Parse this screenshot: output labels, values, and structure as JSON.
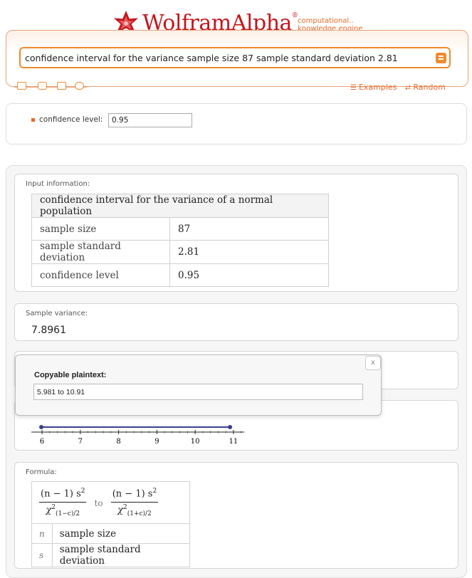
{
  "brand": {
    "name_part1": "Wolfram",
    "name_part2": "Alpha",
    "tagline_line1": "computational..",
    "tagline_line2": "knowledge engine",
    "color": "#c4161c",
    "accent": "#f08b2d"
  },
  "search": {
    "query": "confidence interval for the variance sample size 87 sample standard deviation 2.81"
  },
  "toolbar": {
    "icons": [
      "keyboard-icon",
      "camera-icon",
      "table-icon",
      "upload-icon"
    ],
    "examples_label": "Examples",
    "random_label": "Random"
  },
  "parameters": {
    "confidence_label": "confidence level:",
    "confidence_value": "0.95"
  },
  "pods": {
    "input_info": {
      "title": "Input information:",
      "header": "confidence interval for the variance of a normal population",
      "rows": [
        {
          "label": "sample size",
          "value": "87"
        },
        {
          "label": "sample standard deviation",
          "value": "2.81"
        },
        {
          "label": "confidence level",
          "value": "0.95"
        }
      ]
    },
    "sample_variance": {
      "title": "Sample variance:",
      "value": "7.8961"
    },
    "number_line": {
      "ticks": [
        "6",
        "7",
        "8",
        "9",
        "10",
        "11"
      ],
      "interval": [
        5.981,
        10.91
      ],
      "axis_range": [
        5.72,
        11.28
      ]
    },
    "formula": {
      "title": "Formula:",
      "numerator": "(n − 1) s",
      "exponent": "2",
      "chi": "χ",
      "sub_left": "(1−c)/2",
      "sub_right": "(1+c)/2",
      "connector": "to",
      "rows": [
        {
          "symbol": "n",
          "meaning": "sample size"
        },
        {
          "symbol": "s",
          "meaning": "sample standard deviation"
        }
      ]
    }
  },
  "popup": {
    "title": "Copyable plaintext:",
    "text": "5.981 to 10.91",
    "close_label": "x"
  },
  "chart_data": {
    "type": "line",
    "x": [
      5.981,
      10.91
    ],
    "y": [
      0,
      0
    ],
    "xlim": [
      5.72,
      11.28
    ],
    "xticks": [
      6,
      7,
      8,
      9,
      10,
      11
    ],
    "grid": false
  }
}
